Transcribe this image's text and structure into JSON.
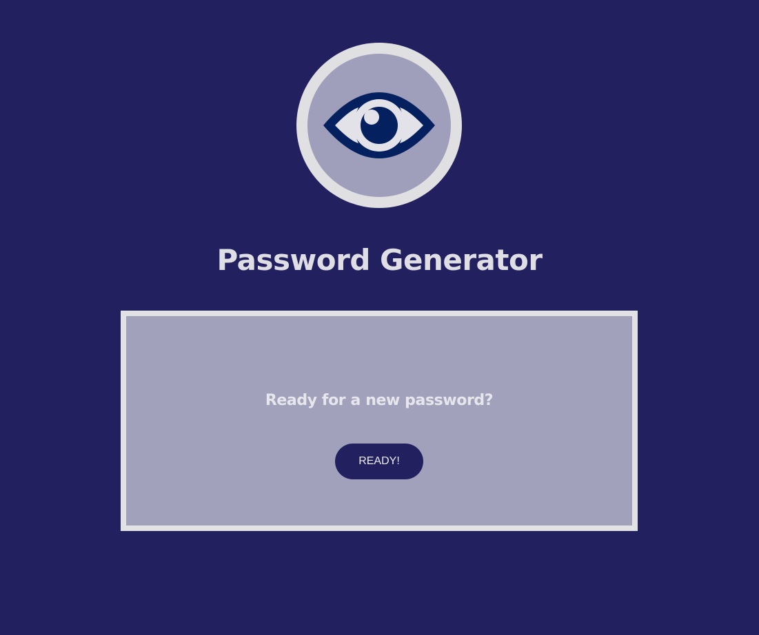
{
  "app": {
    "title": "Password Generator"
  },
  "logo": {
    "icon": "eye-icon"
  },
  "panel": {
    "prompt": "Ready for a new password?",
    "button_label": "READY!"
  },
  "colors": {
    "page_background": "#232060",
    "logo_ring": "#e0e0e2",
    "logo_fill": "#a09fbb",
    "eye_color": "#04205e",
    "panel_background": "#a1a1bb",
    "panel_border": "#e2e2e4",
    "button_background": "#232060",
    "text_light": "#dedee4"
  }
}
